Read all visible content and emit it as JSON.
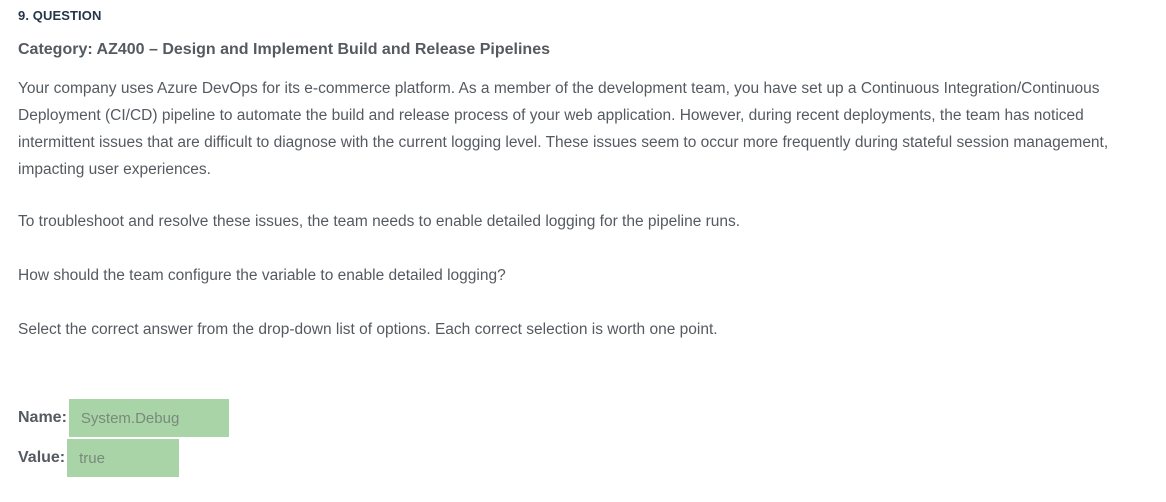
{
  "question": {
    "number": "9. QUESTION",
    "category": "Category: AZ400 – Design and Implement Build and Release Pipelines",
    "paragraphs": [
      "Your company uses Azure DevOps for its e-commerce platform. As a member of the development team, you have set up a Continuous Integration/Continuous Deployment (CI/CD) pipeline to automate the build and release process of your web application. However, during recent deployments, the team has noticed intermittent issues that are difficult to diagnose with the current logging level. These issues seem to occur more frequently during stateful session management, impacting user experiences.",
      "To troubleshoot and resolve these issues, the team needs to enable detailed logging for the pipeline runs.",
      "How should the team configure the variable to enable detailed logging?",
      "Select the correct answer from the drop-down list of options. Each correct selection is worth one point."
    ]
  },
  "answers": {
    "name_label": "Name:",
    "name_value": "System.Debug",
    "value_label": "Value:",
    "value_value": "true"
  },
  "colors": {
    "answer_box": "#a8d4a8",
    "text": "#555a60",
    "heading": "#27354a"
  }
}
